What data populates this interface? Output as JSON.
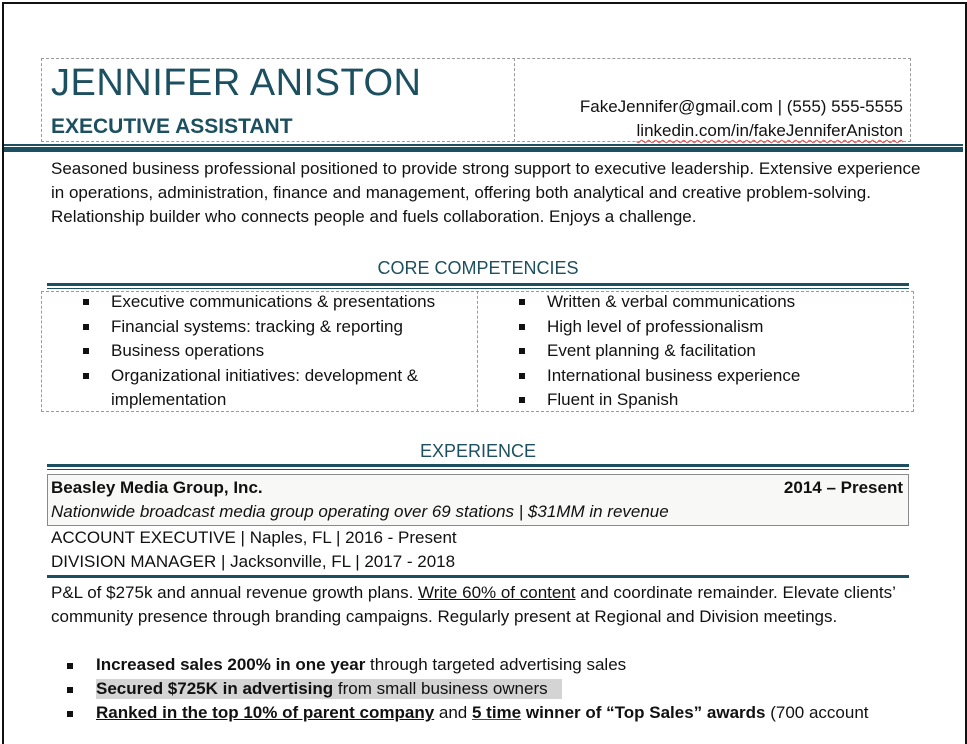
{
  "header": {
    "name": "JENNIFER ANISTON",
    "title": "EXECUTIVE ASSISTANT",
    "contact_line1": "FakeJennifer@gmail.com | (555) 555-5555",
    "linkedin": "linkedin.com/in/fakeJenniferAniston"
  },
  "summary": "Seasoned business professional positioned to provide strong support to executive leadership. Extensive experience in operations, administration, finance and management, offering both analytical and creative problem-solving. Relationship builder who connects people and fuels collaboration. Enjoys a challenge.",
  "competencies": {
    "heading": "CORE COMPETENCIES",
    "left": [
      "Executive communications & presentations",
      "Financial systems: tracking & reporting",
      "Business operations",
      "Organizational initiatives: development & implementation"
    ],
    "right": [
      "Written & verbal communications",
      "High level of professionalism",
      "Event planning & facilitation",
      "International business experience",
      "Fluent in Spanish"
    ]
  },
  "experience": {
    "heading": "EXPERIENCE",
    "company": "Beasley Media Group, Inc.",
    "dates": "2014 – Present",
    "company_description": "Nationwide broadcast media group operating over 69 stations | $31MM in revenue",
    "roles": [
      "ACCOUNT EXECUTIVE | Naples, FL | 2016 - Present",
      "DIVISION MANAGER | Jacksonville, FL | 2017 - 2018"
    ],
    "description": {
      "part1": "P&L of $275k and annual revenue growth plans. ",
      "underlined": "Write 60% of content",
      "part2": " and coordinate remainder. Elevate clients’ community presence through branding campaigns. Regularly present at Regional and Division meetings."
    },
    "achievements": [
      {
        "bold": "Increased sales 200% in one year",
        "rest": " through targeted advertising sales"
      },
      {
        "bold": "Secured $725K in advertising",
        "rest": " from small business owners"
      },
      {
        "bold": "Ranked in the top 10% of parent company",
        "mid": " and ",
        "underlined_bold": "5 time",
        "bold2": " winner of “Top Sales” awards",
        "rest": " (700 account"
      }
    ]
  }
}
